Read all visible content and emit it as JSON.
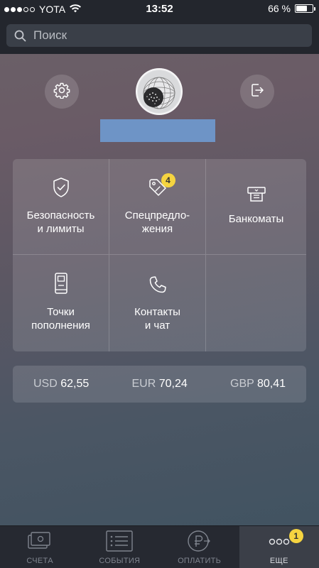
{
  "status_bar": {
    "carrier": "YOTA",
    "time": "13:52",
    "battery": "66 %",
    "battery_level": 0.66,
    "signal_bars_filled": 3,
    "signal_bars_total": 5
  },
  "search": {
    "placeholder": "Поиск",
    "value": ""
  },
  "profile": {
    "settings_icon": "gear-icon",
    "logout_icon": "logout-icon"
  },
  "menu": {
    "items": [
      {
        "label": "Безопасность\nи лимиты",
        "icon": "shield-check-icon"
      },
      {
        "label": "Спецпредло-\nжения",
        "icon": "tag-icon",
        "badge": "4"
      },
      {
        "label": "Банкоматы",
        "icon": "atm-icon"
      },
      {
        "label": "Точки\nпополнения",
        "icon": "terminal-icon"
      },
      {
        "label": "Контакты\nи чат",
        "icon": "phone-icon"
      }
    ]
  },
  "rates": [
    {
      "currency": "USD",
      "value": "62,55"
    },
    {
      "currency": "EUR",
      "value": "70,24"
    },
    {
      "currency": "GBP",
      "value": "80,41"
    }
  ],
  "tabbar": {
    "tabs": [
      {
        "label": "СЧЕТА",
        "icon": "cards-icon"
      },
      {
        "label": "СОБЫТИЯ",
        "icon": "list-icon"
      },
      {
        "label": "ОПЛАТИТЬ",
        "icon": "ruble-pay-icon"
      },
      {
        "label": "ЕЩЕ",
        "icon": "more-dots-icon",
        "badge": "1",
        "active": true
      }
    ]
  },
  "colors": {
    "badge": "#f5d440",
    "status_bar_bg": "#23262d",
    "username_placeholder": "#6e94c6"
  }
}
